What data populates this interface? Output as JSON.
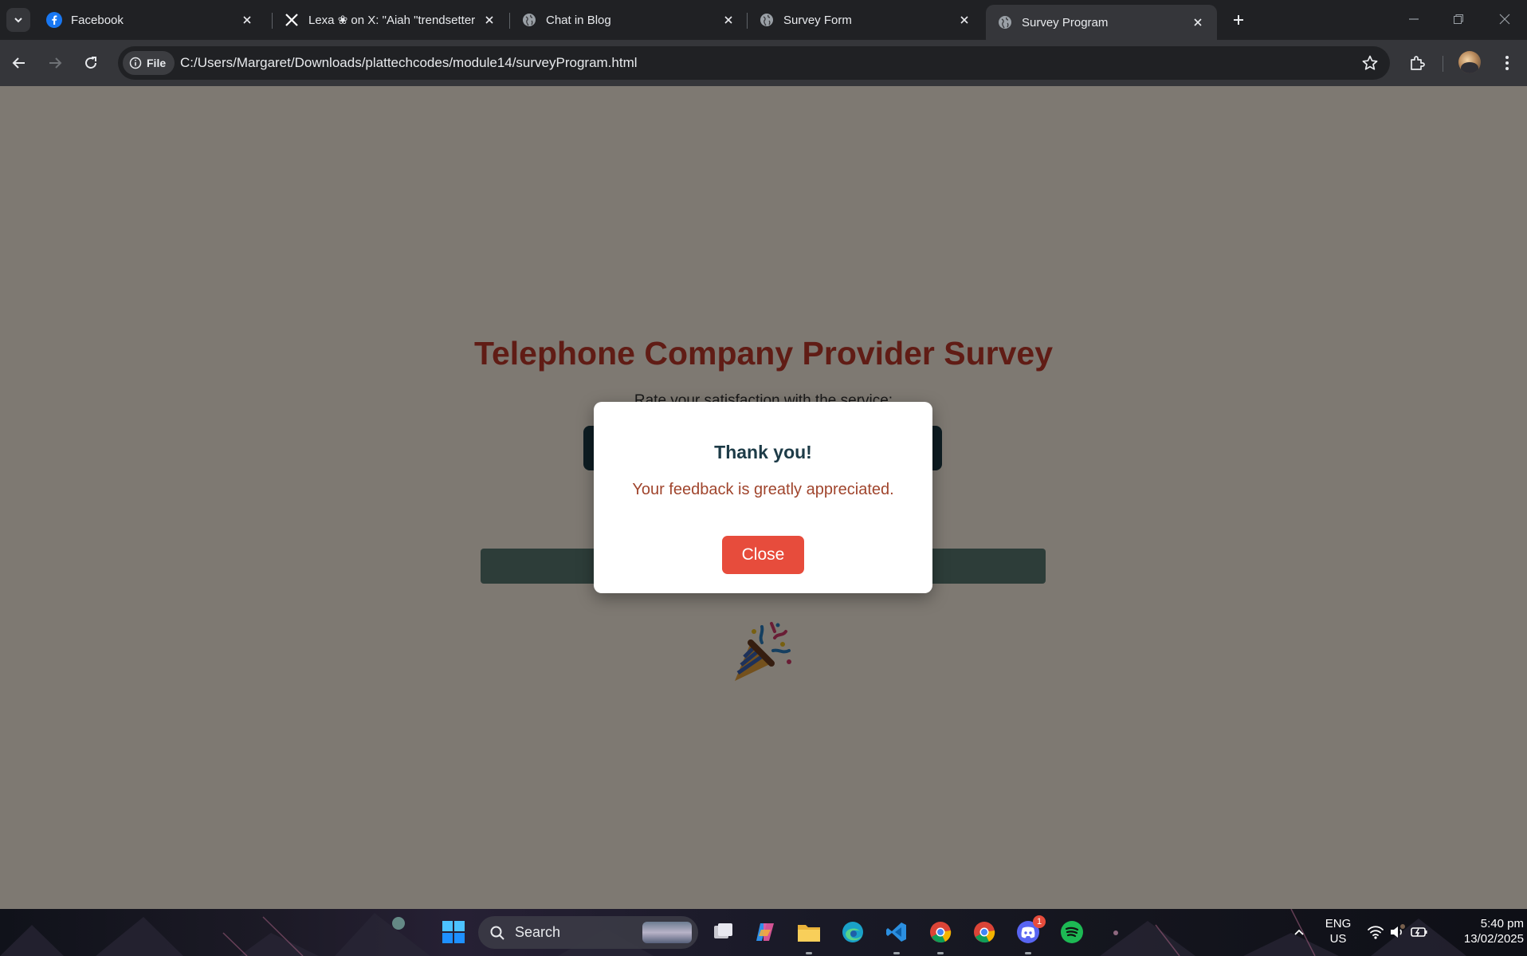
{
  "browser": {
    "tabs": [
      {
        "title": "Facebook",
        "favicon": "facebook-icon",
        "active": false
      },
      {
        "title": "Lexa ❀ on X: \"Aiah \"trendsetter",
        "favicon": "x-icon",
        "active": false
      },
      {
        "title": "Chat in Blog",
        "favicon": "globe-icon",
        "active": false
      },
      {
        "title": "Survey Form",
        "favicon": "globe-icon",
        "active": false
      },
      {
        "title": "Survey Program",
        "favicon": "globe-icon",
        "active": true
      }
    ],
    "address": {
      "scheme_chip": "File",
      "url": "C:/Users/Margaret/Downloads/plattechcodes/module14/surveyProgram.html"
    }
  },
  "page": {
    "title": "Telephone Company Provider Survey",
    "rating_label": "Rate your satisfaction with the service:"
  },
  "modal": {
    "title": "Thank you!",
    "message": "Your feedback is greatly appreciated.",
    "close_label": "Close"
  },
  "taskbar": {
    "search_label": "Search",
    "discord_badge": "1",
    "language": "ENG",
    "region": "US",
    "time": "5:40 pm",
    "date": "13/02/2025"
  },
  "colors": {
    "title_red": "#c0392b",
    "rating_box_dark": "#1d3b47",
    "submit_teal": "#5b7a72",
    "close_button_red": "#e74c3c",
    "message_brown": "#a0452d"
  }
}
